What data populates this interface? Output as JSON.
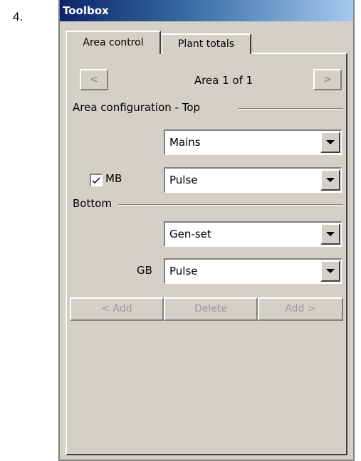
{
  "step_number": "4.",
  "window": {
    "title": "Toolbox"
  },
  "tabs": [
    {
      "label": "Area control",
      "active": true
    },
    {
      "label": "Plant totals",
      "active": false
    }
  ],
  "area_nav": {
    "prev_label": "<",
    "next_label": ">",
    "area_text": "Area 1 of 1"
  },
  "top_group": {
    "label": "Area configuration - Top",
    "source_dropdown": {
      "value": "Mains"
    },
    "breaker_checkbox": {
      "label": "MB",
      "checked": true
    },
    "breaker_dropdown": {
      "value": "Pulse"
    }
  },
  "bottom_group": {
    "label": "Bottom",
    "source_dropdown": {
      "value": "Gen-set"
    },
    "breaker_label": "GB",
    "breaker_dropdown": {
      "value": "Pulse"
    }
  },
  "actions": {
    "add_left_label": "< Add",
    "delete_label": "Delete",
    "add_right_label": "Add >",
    "enabled": false
  },
  "colors": {
    "face": "#d4d0c8",
    "title_start": "#0a246a",
    "title_end": "#a6caf0",
    "disabled_text": "#9a9a9a"
  }
}
